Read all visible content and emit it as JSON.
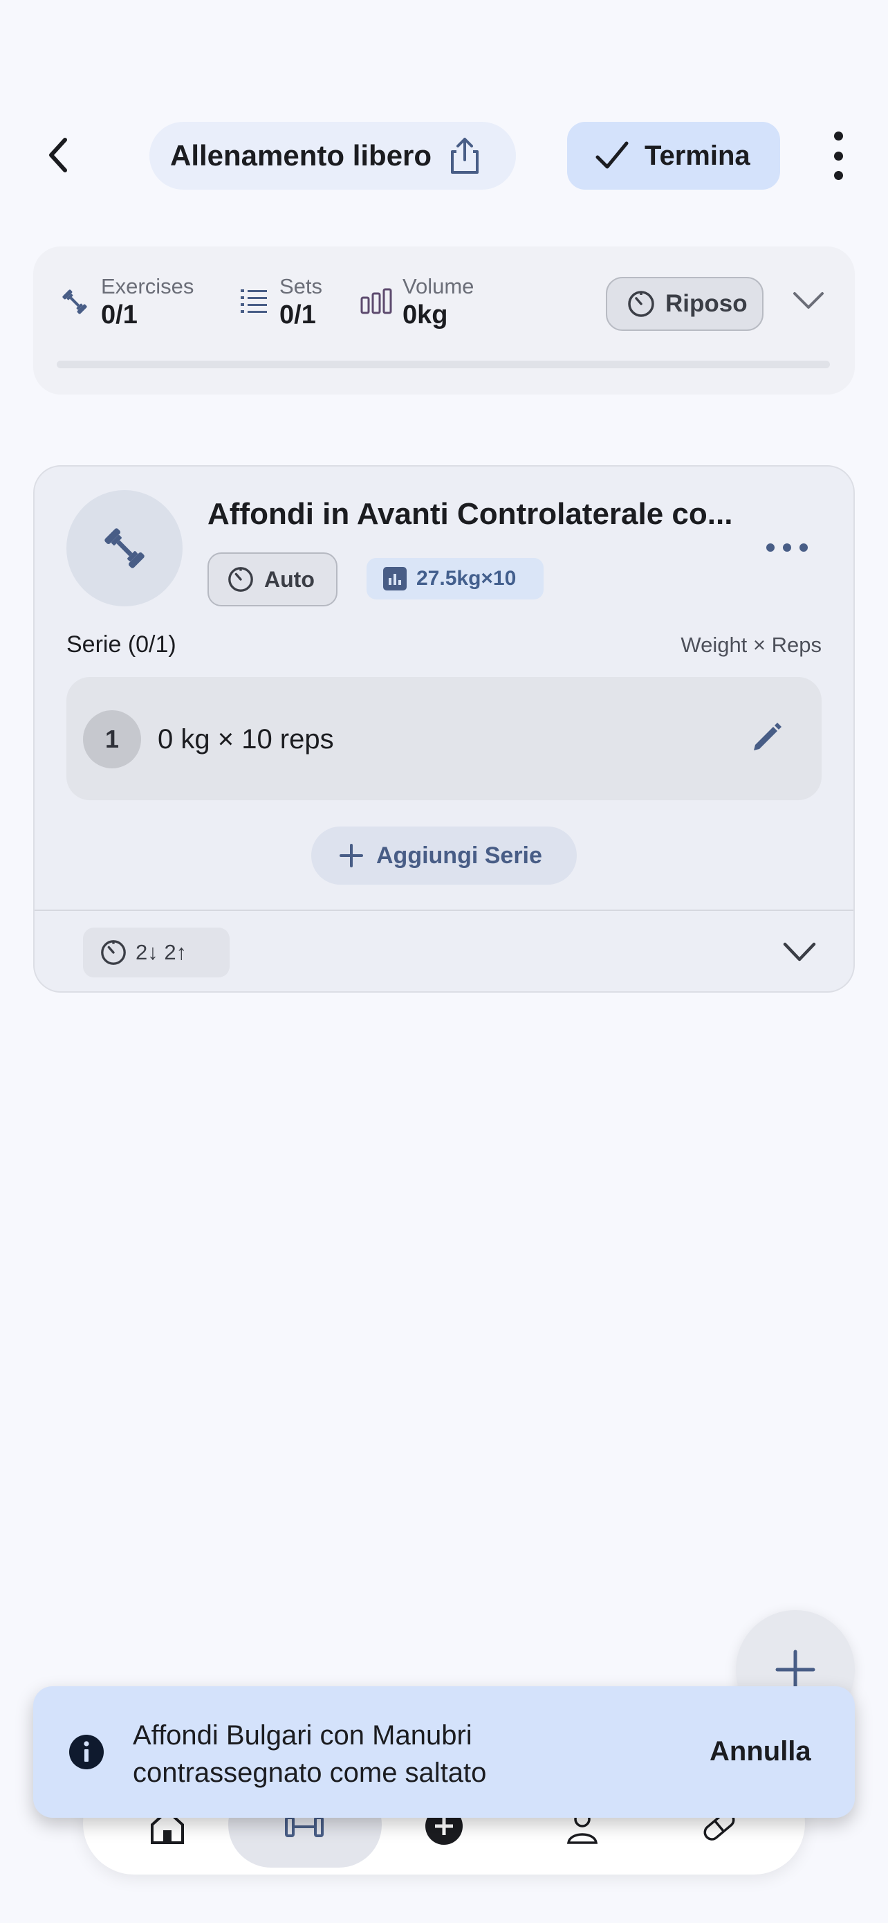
{
  "header": {
    "title": "Allenamento libero",
    "end_label": "Termina"
  },
  "stats": {
    "exercises_label": "Exercises",
    "exercises_value": "0/1",
    "sets_label": "Sets",
    "sets_value": "0/1",
    "volume_label": "Volume",
    "volume_value": "0kg",
    "rest_label": "Riposo",
    "progress": 0
  },
  "exercise": {
    "name": "Affondi in Avanti Controlaterale co...",
    "timer_mode": "Auto",
    "best_set": "27.5kg×10",
    "series_label": "Serie (0/1)",
    "columns_label": "Weight × Reps",
    "sets": [
      {
        "number": "1",
        "text": "0 kg × 10 reps"
      }
    ],
    "add_set_label": "Aggiungi Serie",
    "rest_summary": "2↓ 2↑"
  },
  "snackbar": {
    "message": "Affondi Bulgari con Manubri contrassegnato come saltato",
    "action": "Annulla"
  },
  "colors": {
    "accent": "#485d86",
    "primary_container": "#d4e2fb",
    "background": "#f7f8fd"
  }
}
